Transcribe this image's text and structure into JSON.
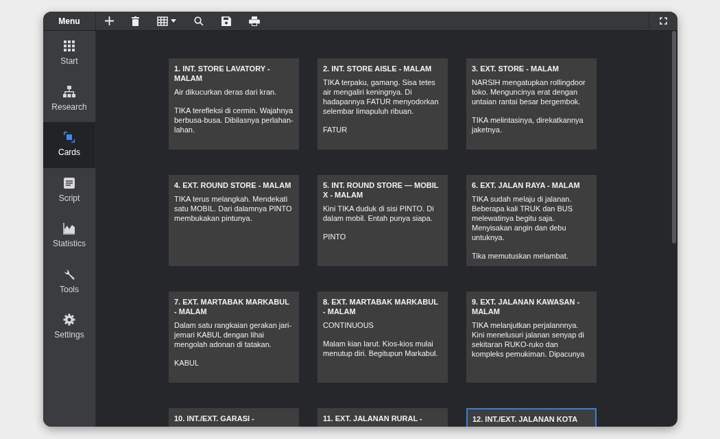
{
  "menu_title": "Menu",
  "toolbar": [
    {
      "kind": "add"
    },
    {
      "kind": "delete"
    },
    {
      "kind": "grid"
    },
    {
      "kind": "search"
    },
    {
      "kind": "save"
    },
    {
      "kind": "print"
    }
  ],
  "sidebar": {
    "items": [
      {
        "label": "Start",
        "kind": "start",
        "selected": false
      },
      {
        "label": "Research",
        "kind": "research",
        "selected": false
      },
      {
        "label": "Cards",
        "kind": "cards",
        "selected": true
      },
      {
        "label": "Script",
        "kind": "script",
        "selected": false
      },
      {
        "label": "Statistics",
        "kind": "statistics",
        "selected": false
      },
      {
        "label": "Tools",
        "kind": "tools",
        "selected": false
      },
      {
        "label": "Settings",
        "kind": "settings",
        "selected": false
      }
    ]
  },
  "cards": [
    {
      "title": "1. INT. STORE LAVATORY - MALAM",
      "body": [
        "Air dikucurkan deras dari kran.",
        "TIKA terefleksi di cermin. Wajahnya berbusa-busa. Dibilasnya perlahan-lahan."
      ],
      "selected": false
    },
    {
      "title": "2. INT. STORE AISLE - MALAM",
      "body": [
        "TIKA terpaku, gamang. Sisa tetes air mengaliri keningnya. Di hadapannya FATUR menyodorkan selembar limapuluh ribuan.",
        "FATUR"
      ],
      "selected": false
    },
    {
      "title": "3. EXT. STORE - MALAM",
      "body": [
        "NARSIH mengatupkan rollingdoor toko. Menguncinya erat dengan untaian rantai besar bergembok.",
        "TIKA melintasinya, direkatkannya jaketnya."
      ],
      "selected": false
    },
    {
      "title": "4. EXT. ROUND STORE - MALAM",
      "body": [
        "TIKA terus melangkah. Mendekati satu MOBIL. Dari dalamnya PINTO membukakan pintunya."
      ],
      "selected": false
    },
    {
      "title": "5. INT. ROUND STORE — MOBIL X - MALAM",
      "body": [
        "Kini TIKA duduk di sisi PINTO. Di dalam mobil. Entah punya siapa.",
        "PINTO"
      ],
      "selected": false
    },
    {
      "title": "6. EXT. JALAN RAYA - MALAM",
      "body": [
        "TIKA sudah melaju di jalanan. Beberapa kali TRUK dan BUS melewatinya begitu saja. Menyisakan angin dan debu untuknya.",
        "Tika memutuskan melambat."
      ],
      "selected": false
    },
    {
      "title": "7. EXT. MARTABAK MARKABUL - MALAM",
      "body": [
        "Dalam satu rangkaian gerakan jari-jemari KABUL dengan lihai mengolah adonan di tatakan.",
        "KABUL"
      ],
      "selected": false
    },
    {
      "title": "8. EXT. MARTABAK MARKABUL - MALAM",
      "body": [
        "CONTINUOUS",
        "Malam kian larut. Kios-kios mulai menutup diri. Begitupun Markabul."
      ],
      "selected": false
    },
    {
      "title": "9. EXT. JALANAN KAWASAN - MALAM",
      "body": [
        "TIKA melanjutkan perjalannnya. Kini menelusuri jalanan senyap di sekitaran RUKO-ruko dan kompleks pemukiman. Dipacunya"
      ],
      "selected": false
    },
    {
      "title": "10. INT./EXT. GARASI -",
      "selected": false
    },
    {
      "title": "11. EXT. JALANAN RURAL -",
      "selected": false
    },
    {
      "title": "12. INT./EXT. JALANAN KOTA",
      "selected": true
    }
  ]
}
